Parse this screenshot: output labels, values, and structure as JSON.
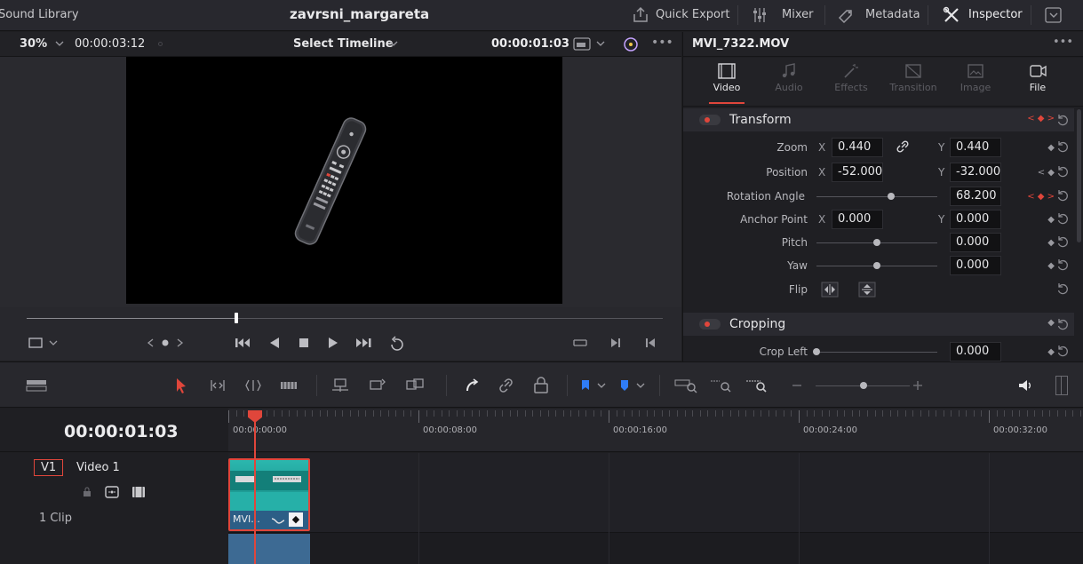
{
  "topbar": {
    "left_label": "Sound Library",
    "project_title": "zavrsni_margareta",
    "quick_export": "Quick Export",
    "mixer": "Mixer",
    "metadata": "Metadata",
    "inspector": "Inspector"
  },
  "viewer": {
    "zoom": "30%",
    "source_timecode": "00:00:03:12",
    "timeline_select": "Select Timeline",
    "current_timecode": "00:00:01:03",
    "scrub_position": 0.33
  },
  "inspector": {
    "clip_name": "MVI_7322.MOV",
    "tabs": [
      {
        "label": "Video",
        "icon": "film-icon",
        "active": true
      },
      {
        "label": "Audio",
        "icon": "music-icon",
        "active": false
      },
      {
        "label": "Effects",
        "icon": "wand-icon",
        "active": false
      },
      {
        "label": "Transition",
        "icon": "transition-icon",
        "active": false
      },
      {
        "label": "Image",
        "icon": "image-icon",
        "active": false
      },
      {
        "label": "File",
        "icon": "file-icon",
        "active": true
      }
    ],
    "transform": {
      "title": "Transform",
      "zoom_label": "Zoom",
      "zoom_x": "0.440",
      "zoom_y": "0.440",
      "position_label": "Position",
      "position_x": "-52.000",
      "position_y": "-32.000",
      "rotation_label": "Rotation Angle",
      "rotation_value": "68.200",
      "rotation_slider": 0.62,
      "anchor_label": "Anchor Point",
      "anchor_x": "0.000",
      "anchor_y": "0.000",
      "pitch_label": "Pitch",
      "pitch_value": "0.000",
      "pitch_slider": 0.5,
      "yaw_label": "Yaw",
      "yaw_value": "0.000",
      "yaw_slider": 0.5,
      "flip_label": "Flip",
      "x_axis": "X",
      "y_axis": "Y"
    },
    "cropping": {
      "title": "Cropping",
      "crop_left_label": "Crop Left",
      "crop_left_value": "0.000",
      "crop_left_slider": 0.0
    }
  },
  "timeline": {
    "timecode": "00:00:01:03",
    "ruler_labels": [
      "00:00:00:00",
      "00:00:08:00",
      "00:00:16:00",
      "00:00:24:00",
      "00:00:32:00"
    ],
    "track_badge": "V1",
    "track_name": "Video 1",
    "clip_count": "1 Clip",
    "clip_name": "MVI..."
  },
  "colors": {
    "accent_red": "#e0463b",
    "marker_blue": "#2f7cf6",
    "clip_teal": "#1a8f8a",
    "clip_bar_blue": "#2c5e86"
  }
}
